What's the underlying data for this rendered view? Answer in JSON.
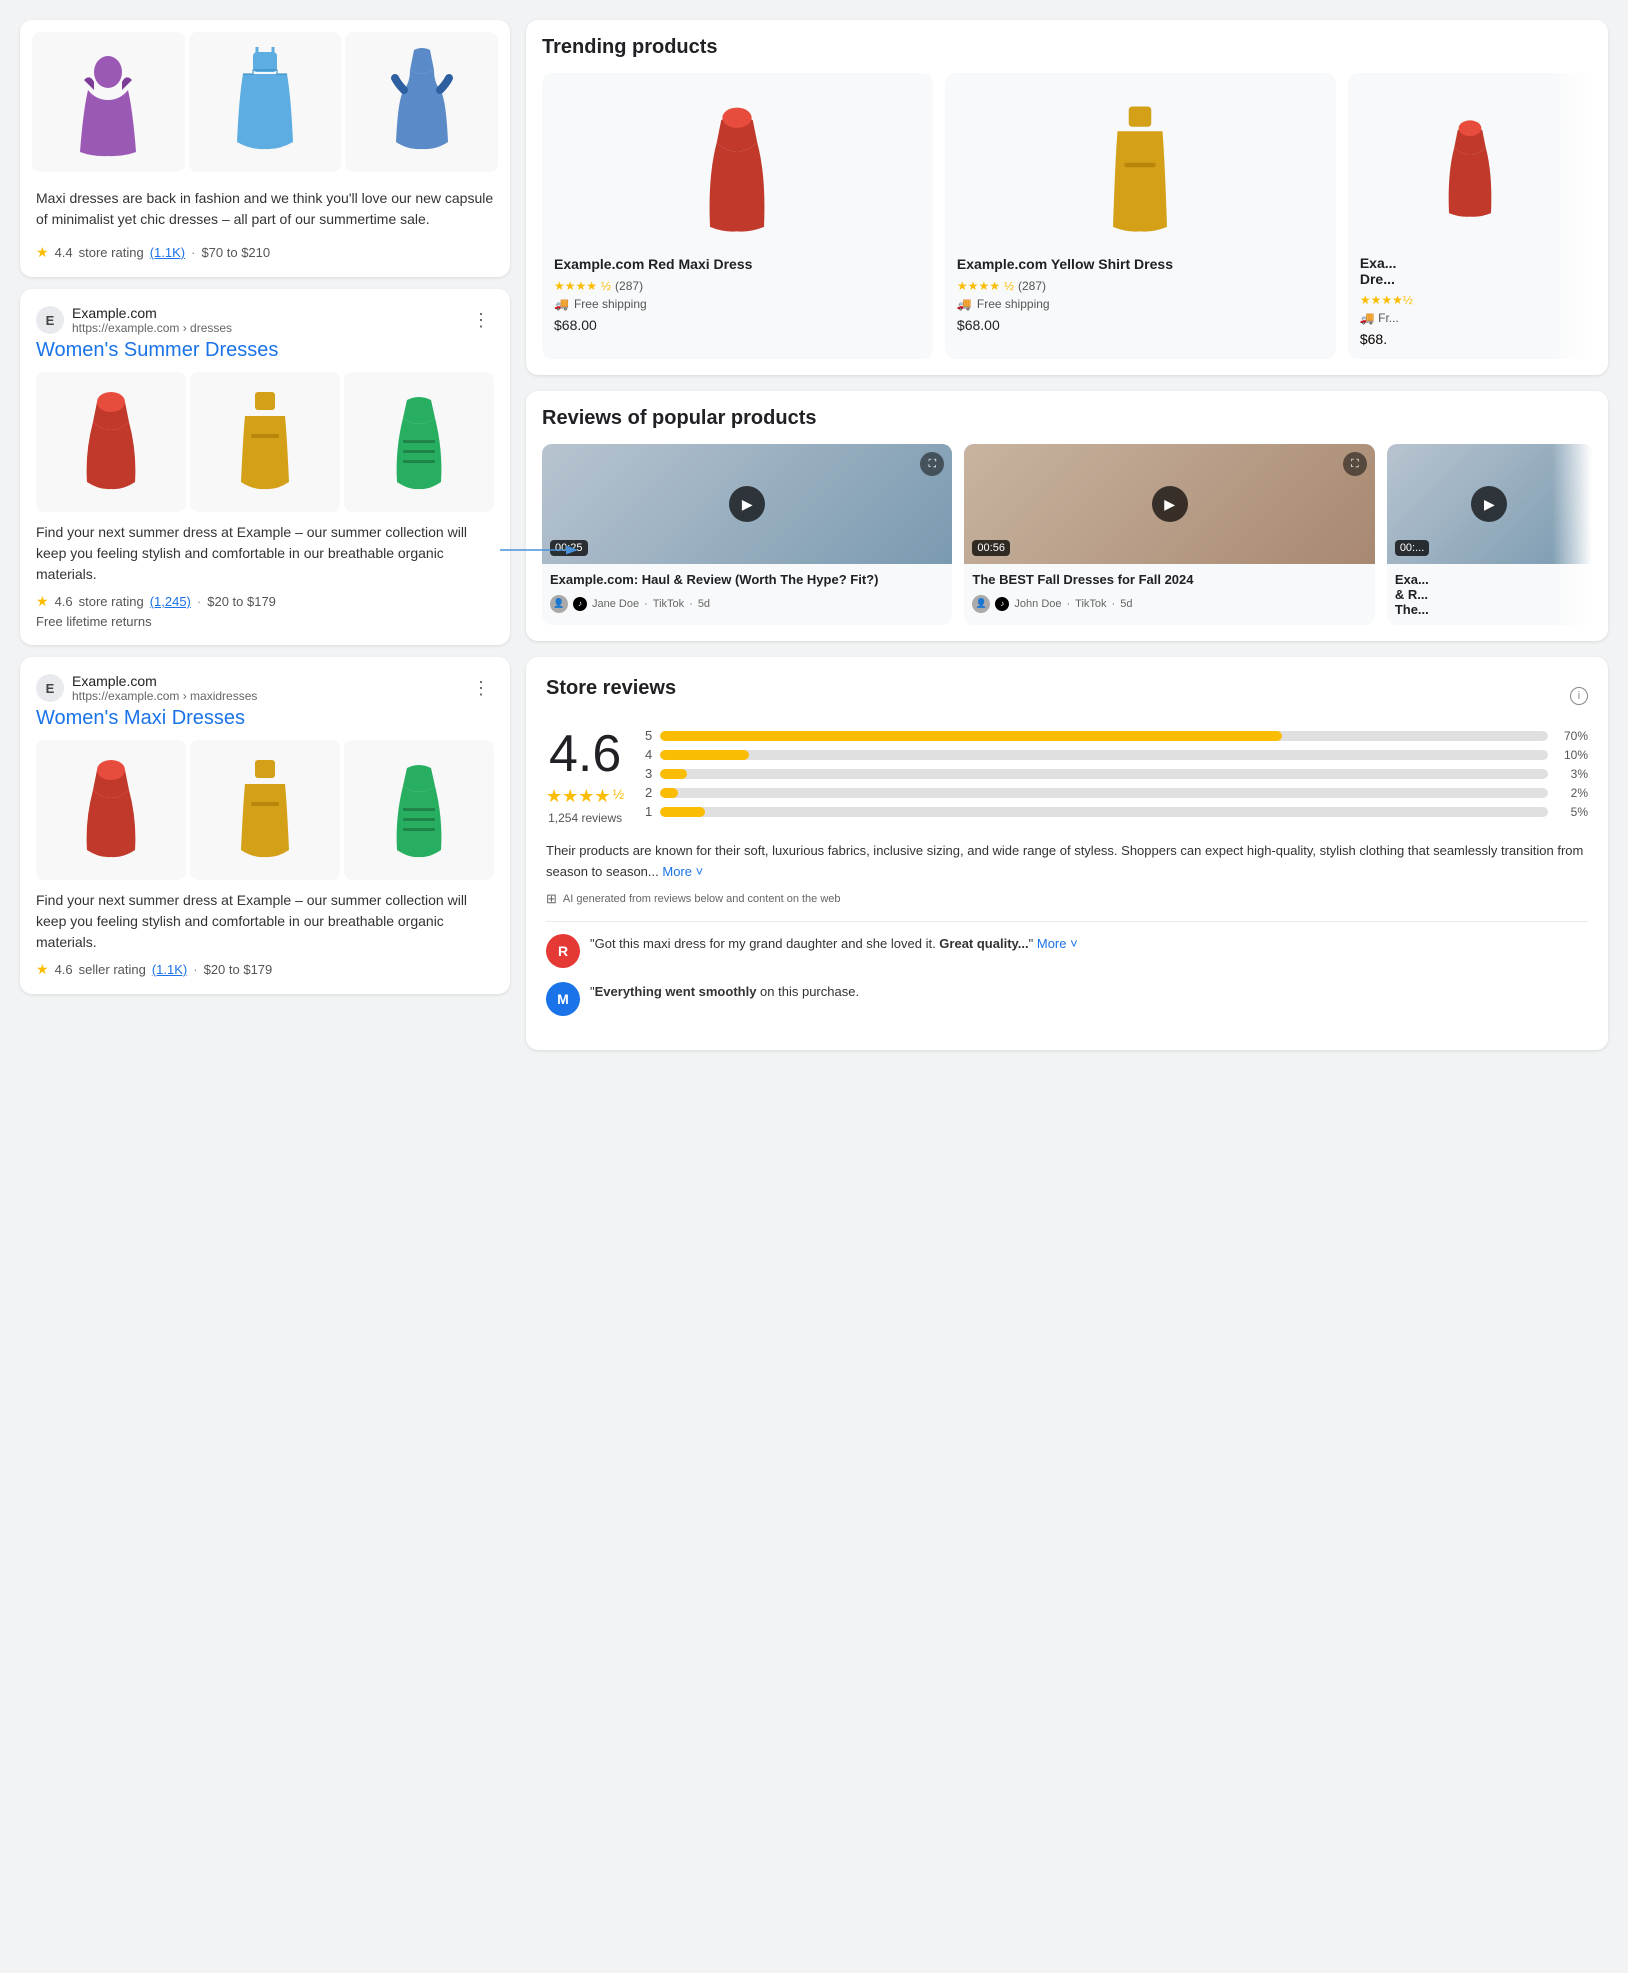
{
  "left": {
    "top_card": {
      "description": "Maxi dresses are back in fashion and we think you'll love our new capsule of minimalist yet chic dresses – all part of our summertime sale.",
      "rating": "4.4",
      "rating_count": "1.1K",
      "price_range": "$70 to $210",
      "dresses": [
        {
          "color": "purple",
          "fill": "#9b59b6",
          "accent": "#7d3c98"
        },
        {
          "color": "teal",
          "fill": "#5dade2",
          "accent": "#2e86c1"
        },
        {
          "color": "blue",
          "fill": "#5b8ac8",
          "accent": "#2e5fa0"
        }
      ]
    },
    "entry1": {
      "site_initial": "E",
      "site_name": "Example.com",
      "site_url": "https://example.com › dresses",
      "title": "Women's Summer Dresses",
      "description": "Find your next summer dress at Example – our summer collection will keep you feeling stylish and comfortable in our breathable organic materials.",
      "rating": "4.6",
      "rating_count": "1,245",
      "price_range": "$20 to $179",
      "free_returns": "Free lifetime returns",
      "dresses": [
        {
          "color": "red",
          "fill": "#c0392b",
          "accent": "#a93226"
        },
        {
          "color": "yellow",
          "fill": "#d4a017",
          "accent": "#b7860b"
        },
        {
          "color": "green",
          "fill": "#27ae60",
          "accent": "#1e8449"
        }
      ]
    },
    "entry2": {
      "site_initial": "E",
      "site_name": "Example.com",
      "site_url": "https://example.com › maxidresses",
      "title": "Women's Maxi Dresses",
      "description": "Find your next summer dress at Example – our summer collection will keep you feeling stylish and comfortable in our breathable organic materials.",
      "rating": "4.6",
      "rating_type": "seller rating",
      "rating_count": "1.1K",
      "price_range": "$20 to $179",
      "dresses": [
        {
          "color": "red",
          "fill": "#c0392b",
          "accent": "#a93226"
        },
        {
          "color": "yellow",
          "fill": "#d4a017",
          "accent": "#b7860b"
        },
        {
          "color": "green",
          "fill": "#27ae60",
          "accent": "#1e8449"
        }
      ]
    }
  },
  "right": {
    "trending": {
      "title": "Trending products",
      "products": [
        {
          "name": "Example.com Red Maxi Dress",
          "rating": "4.5",
          "reviews": "287",
          "shipping": "Free shipping",
          "price": "$68.00",
          "dress_color": "#c0392b",
          "dress_accent": "#a93226"
        },
        {
          "name": "Example.com Yellow Shirt Dress",
          "rating": "4.5",
          "reviews": "287",
          "shipping": "Free shipping",
          "price": "$68.00",
          "dress_color": "#d4a017",
          "dress_accent": "#b7860b"
        },
        {
          "name": "Exa... Dre...",
          "rating": "4.5",
          "shipping": "Fr...",
          "price": "$68.",
          "partial": true,
          "dress_color": "#c0392b",
          "dress_accent": "#a93226"
        }
      ]
    },
    "reviews_popular": {
      "title": "Reviews of popular products",
      "videos": [
        {
          "duration": "00:25",
          "title": "Example.com: Haul & Review (Worth The Hype? Fit?)",
          "author": "Jane Doe",
          "platform": "TikTok",
          "time_ago": "5d",
          "bg": "1"
        },
        {
          "duration": "00:56",
          "title": "The BEST Fall Dresses for Fall 2024",
          "author": "John Doe",
          "platform": "TikTok",
          "time_ago": "5d",
          "bg": "2"
        },
        {
          "duration": "00:...",
          "title": "Exa... & R... The...",
          "partial": true,
          "bg": "1"
        }
      ]
    },
    "store_reviews": {
      "title": "Store reviews",
      "overall_rating": "4.6",
      "total_reviews": "1,254 reviews",
      "bars": [
        {
          "star": "5",
          "pct": 70,
          "label": "70%"
        },
        {
          "star": "4",
          "pct": 10,
          "label": "10%"
        },
        {
          "star": "3",
          "pct": 3,
          "label": "3%"
        },
        {
          "star": "2",
          "pct": 2,
          "label": "2%"
        },
        {
          "star": "1",
          "pct": 5,
          "label": "5%"
        }
      ],
      "ai_summary": "Their products are known for their soft, luxurious fabrics, inclusive sizing, and wide range of styless. Shoppers can expect high-quality, stylish clothing that seamlessly transition from season to season...",
      "ai_note": "AI generated from reviews below and content on the web",
      "user_reviews": [
        {
          "initial": "R",
          "bg_color": "#e53935",
          "text": "\"Got this maxi dress for my grand daughter and she loved it. ",
          "bold_part": "Great quality...",
          "more": "More"
        },
        {
          "initial": "M",
          "bg_color": "#1a73e8",
          "text": "\"",
          "bold_part": "Everything went smoothly",
          "text_after": " on this purchase.",
          "more": ""
        }
      ],
      "more_label": "More",
      "stars_count": 4,
      "half_star": true
    }
  },
  "icons": {
    "star": "★",
    "half_star": "½",
    "truck": "🚚",
    "play": "▶",
    "expand": "⛶",
    "more_vert": "⋮",
    "info": "i",
    "tiktok": "♪"
  }
}
